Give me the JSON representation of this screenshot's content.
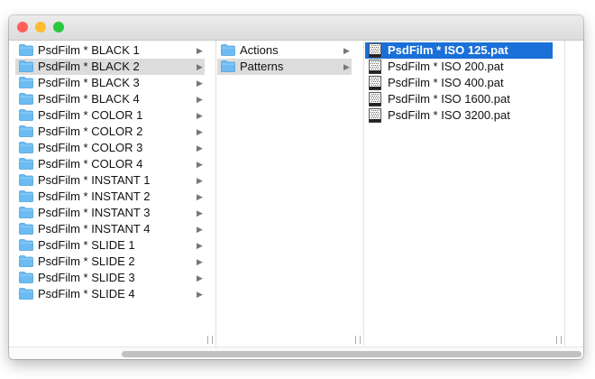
{
  "colors": {
    "close": "#fe5f57",
    "minimize": "#febc2e",
    "zoom": "#28c840",
    "selection_blue": "#1a6fd8",
    "selection_gray": "#dcdcdc",
    "folder": "#6cbcf3"
  },
  "columns": [
    {
      "items": [
        {
          "label": "PsdFilm * BLACK 1",
          "icon": "folder-icon",
          "has_children": true
        },
        {
          "label": "PsdFilm * BLACK 2",
          "icon": "folder-icon",
          "has_children": true,
          "selected": "gray"
        },
        {
          "label": "PsdFilm * BLACK 3",
          "icon": "folder-icon",
          "has_children": true
        },
        {
          "label": "PsdFilm * BLACK 4",
          "icon": "folder-icon",
          "has_children": true
        },
        {
          "label": "PsdFilm * COLOR 1",
          "icon": "folder-icon",
          "has_children": true
        },
        {
          "label": "PsdFilm * COLOR 2",
          "icon": "folder-icon",
          "has_children": true
        },
        {
          "label": "PsdFilm * COLOR 3",
          "icon": "folder-icon",
          "has_children": true
        },
        {
          "label": "PsdFilm * COLOR 4",
          "icon": "folder-icon",
          "has_children": true
        },
        {
          "label": "PsdFilm * INSTANT 1",
          "icon": "folder-icon",
          "has_children": true
        },
        {
          "label": "PsdFilm * INSTANT 2",
          "icon": "folder-icon",
          "has_children": true
        },
        {
          "label": "PsdFilm * INSTANT 3",
          "icon": "folder-icon",
          "has_children": true
        },
        {
          "label": "PsdFilm * INSTANT 4",
          "icon": "folder-icon",
          "has_children": true
        },
        {
          "label": "PsdFilm * SLIDE 1",
          "icon": "folder-icon",
          "has_children": true
        },
        {
          "label": "PsdFilm * SLIDE 2",
          "icon": "folder-icon",
          "has_children": true
        },
        {
          "label": "PsdFilm * SLIDE 3",
          "icon": "folder-icon",
          "has_children": true
        },
        {
          "label": "PsdFilm * SLIDE 4",
          "icon": "folder-icon",
          "has_children": true
        }
      ]
    },
    {
      "items": [
        {
          "label": "Actions",
          "icon": "folder-icon",
          "has_children": true
        },
        {
          "label": "Patterns",
          "icon": "folder-icon",
          "has_children": true,
          "selected": "gray"
        }
      ]
    },
    {
      "items": [
        {
          "label": "PsdFilm * ISO 125.pat",
          "icon": "pattern-file-icon",
          "has_children": false,
          "selected": "blue"
        },
        {
          "label": "PsdFilm * ISO 200.pat",
          "icon": "pattern-file-icon",
          "has_children": false
        },
        {
          "label": "PsdFilm * ISO 400.pat",
          "icon": "pattern-file-icon",
          "has_children": false
        },
        {
          "label": "PsdFilm * ISO 1600.pat",
          "icon": "pattern-file-icon",
          "has_children": false
        },
        {
          "label": "PsdFilm * ISO 3200.pat",
          "icon": "pattern-file-icon",
          "has_children": false
        }
      ]
    }
  ]
}
